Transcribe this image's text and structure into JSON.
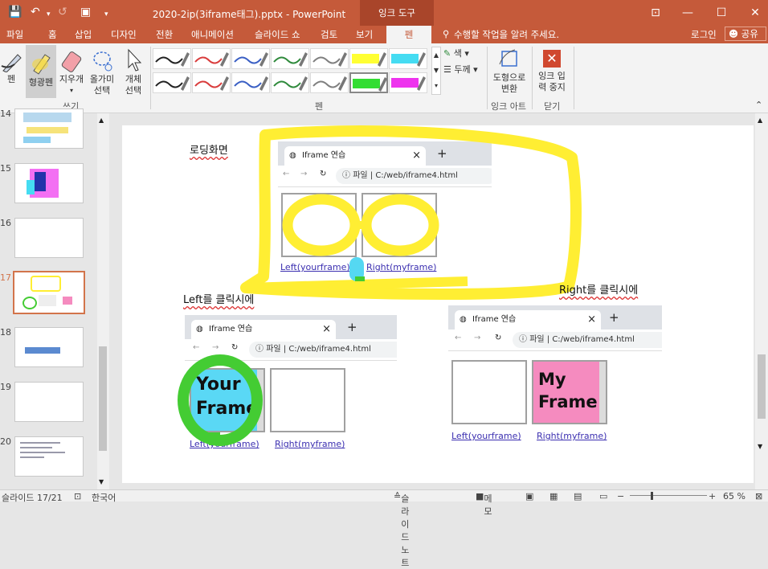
{
  "window": {
    "title": "2020-2ip(3iframe태그).pptx - PowerPoint",
    "context_tab": "잉크 도구",
    "qat": {
      "save": "💾",
      "undo": "↶",
      "redo": "↺",
      "present": "▣",
      "more": "▾"
    },
    "controls": {
      "ribbon_display": "⊡",
      "minimize": "—",
      "maximize": "☐",
      "close": "✕"
    }
  },
  "menu": {
    "tabs": [
      "파일",
      "홈",
      "삽입",
      "디자인",
      "전환",
      "애니메이션",
      "슬라이드 쇼",
      "검토",
      "보기"
    ],
    "active_tab": "펜",
    "tell_me": "수행할 작업을 알려 주세요.",
    "signin": "로그인",
    "share": "공유"
  },
  "ribbon": {
    "write_group": {
      "label": "쓰기",
      "pen": "펜",
      "highlighter": "형광펜",
      "eraser": "지우개",
      "lasso": [
        "올가미",
        "선택"
      ],
      "object_select": [
        "개체",
        "선택"
      ]
    },
    "pens_group": {
      "label": "펜",
      "color": "색",
      "thickness": "두께",
      "pens": [
        {
          "color": "#222222",
          "style": "pen"
        },
        {
          "color": "#d93c3c",
          "style": "pen"
        },
        {
          "color": "#3a5fc4",
          "style": "pen"
        },
        {
          "color": "#2f8a3c",
          "style": "pen"
        },
        {
          "color": "#7f7f7f",
          "style": "pen"
        },
        {
          "color": "#ffff33",
          "style": "highlighter"
        },
        {
          "color": "#45dcf2",
          "style": "highlighter"
        },
        {
          "color": "#222222",
          "style": "pen"
        },
        {
          "color": "#d93c3c",
          "style": "pen"
        },
        {
          "color": "#3a5fc4",
          "style": "pen"
        },
        {
          "color": "#2f8a3c",
          "style": "pen"
        },
        {
          "color": "#7f7f7f",
          "style": "pen"
        },
        {
          "color": "#33dd33",
          "style": "highlighter"
        },
        {
          "color": "#ee33ee",
          "style": "highlighter"
        }
      ]
    },
    "ink_art_group": {
      "label": "잉크 아트",
      "convert": [
        "도형으로",
        "변환"
      ]
    },
    "close_group": {
      "label": "닫기",
      "stop": [
        "잉크 입",
        "력 중지"
      ]
    }
  },
  "thumbnails": [
    {
      "num": "14"
    },
    {
      "num": "15"
    },
    {
      "num": "16"
    },
    {
      "num": "17",
      "selected": true
    },
    {
      "num": "18"
    },
    {
      "num": "19"
    },
    {
      "num": "20"
    }
  ],
  "slide": {
    "loading_caption": "로딩화면",
    "left_caption": "Left를 클릭시에",
    "right_caption": "Right를 클릭시에",
    "browser_tab": "Iframe 연습",
    "tab_close": "×",
    "new_tab": "+",
    "file_label": "파일",
    "url": "C:/web/iframe4.html",
    "link_left": "Left(yourframe)",
    "link_right": "Right(myframe)",
    "your_frame_text": "Your Frame",
    "my_frame_text": "My Frame",
    "colors": {
      "highlight_yellow": "#ffee33",
      "highlight_green": "#44cc33",
      "highlight_cyan": "#55d8f2",
      "your_frame_bg": "#5ad8f5",
      "my_frame_bg": "#f58bbf"
    }
  },
  "status": {
    "slide_info": "슬라이드 17/21",
    "language": "한국어",
    "notes": "슬라이드 노트",
    "comments": "메모",
    "zoom": "65 %"
  }
}
